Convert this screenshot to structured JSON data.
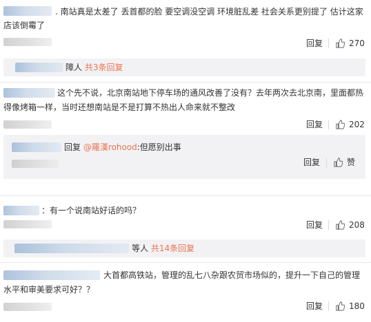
{
  "comments": [
    {
      "text_line1": ". 南站真是太差了 丢首都的脸 要空调没空调 环境脏乱差 社会关系更别提了 估计这家",
      "text_line2": "店该倒霉了",
      "reply_label": "回复",
      "likes": "270",
      "summary_suffix": "障人",
      "summary_link": "共3条回复"
    },
    {
      "text_line1": "这个先不说，北京南站地下停车场的通风改善了没有？去年两次去北京南，里面都热",
      "text_line2": "得像烤箱一样，当时还想南站是不是打算不热出人命来就不整改",
      "reply_label": "回复",
      "likes": "202",
      "sub_reply": {
        "prefix": "回复",
        "mention": "@羅漢rohood",
        "text": ":但愿别出事",
        "reply_label": "回复",
        "like_label": "赞"
      }
    },
    {
      "text_line1": "：有一个说南站好话的吗？",
      "reply_label": "回复",
      "likes": "208",
      "summary_suffix": "等人",
      "summary_link": "共14条回复"
    },
    {
      "text_line1": "大首都高铁站，管理的乱七八杂跟农贸市场似的，提升一下自己的管理",
      "text_line2": "水平和审美要求可好？？",
      "reply_label": "回复",
      "likes": "180"
    }
  ],
  "icons": {
    "like": "thumbs-up-icon"
  },
  "colors": {
    "link": "#eb7350",
    "reply_bg": "#f2f2f5",
    "text": "#333333"
  }
}
